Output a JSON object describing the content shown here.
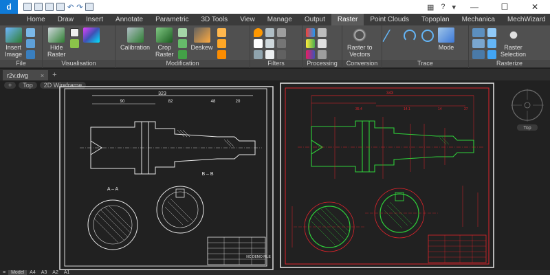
{
  "app": {
    "logo_letter": "d"
  },
  "window_controls": {
    "help": "?",
    "minimize": "—",
    "maximize": "☐",
    "close": "✕"
  },
  "tabs": [
    "Home",
    "Draw",
    "Insert",
    "Annotate",
    "Parametric",
    "3D Tools",
    "View",
    "Manage",
    "Output",
    "Raster",
    "Point Clouds",
    "Topoplan",
    "Mechanica",
    "MechWizard"
  ],
  "active_tab": "Raster",
  "ribbon": {
    "file": {
      "label": "File",
      "insert_image": "Insert\nImage"
    },
    "visualisation": {
      "label": "Visualisation",
      "hide_raster": "Hide\nRaster"
    },
    "modification": {
      "label": "Modification",
      "calibration": "Calibration",
      "crop_raster": "Crop\nRaster",
      "deskew": "Deskew"
    },
    "filters": {
      "label": "Filters"
    },
    "processing": {
      "label": "Processing"
    },
    "conversion": {
      "label": "Conversion",
      "raster_to_vectors": "Raster to\nVectors"
    },
    "trace": {
      "label": "Trace",
      "mode": "Mode"
    },
    "rasterize": {
      "label": "Rasterize",
      "raster_selection": "Raster\nSelection"
    }
  },
  "document": {
    "tab_name": "r2v.dwg",
    "close": "×",
    "add": "+"
  },
  "viewport": {
    "labels": [
      "+",
      "Top",
      "2D Wireframe"
    ],
    "viewcube_label": "Top"
  },
  "drawing": {
    "overall_dim": "323",
    "dims_top": [
      "90",
      "82",
      "48",
      "20"
    ],
    "section_aa": "A – A",
    "section_bb": "B – B",
    "title_block": "NC DEMO FILE",
    "vector_dims": [
      "343",
      "35.4",
      "14.1",
      "14",
      "27"
    ]
  },
  "status": {
    "layouts": [
      "Model",
      "A4",
      "A3",
      "A2",
      "A1"
    ],
    "active_layout": "Model"
  },
  "colors": {
    "accent": "#0f7bd8",
    "vector_red": "#e0232b",
    "vector_green": "#2fd13a",
    "drawing_white": "#e8e8e8"
  }
}
